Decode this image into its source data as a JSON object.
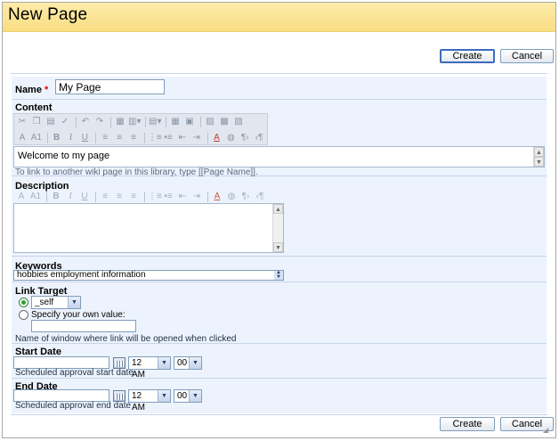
{
  "page": {
    "title": "New Page"
  },
  "actions": {
    "create_label": "Create",
    "cancel_label": "Cancel"
  },
  "form": {
    "name": {
      "label": "Name",
      "required_mark": "*",
      "value": "My Page"
    },
    "content": {
      "label": "Content",
      "value": "Welcome to my page",
      "hint": "To link to another wiki page in this library, type [[Page Name]].",
      "toolbar_icons": {
        "row1": [
          "cut-icon",
          "copy-icon",
          "paste-icon",
          "spellcheck-icon",
          "undo-icon",
          "redo-icon",
          "table-icon",
          "insert-table-icon",
          "insert-row-icon",
          "table-props-icon",
          "cell-props-icon",
          "insert-image-icon",
          "link-icon",
          "anchor-icon"
        ],
        "row2": [
          "font-icon",
          "font-size-icon",
          "bold-icon",
          "italic-icon",
          "underline-icon",
          "align-left-icon",
          "align-center-icon",
          "align-right-icon",
          "numbered-list-icon",
          "bullet-list-icon",
          "decrease-indent-icon",
          "increase-indent-icon",
          "text-color-icon",
          "background-color-icon",
          "ltr-icon",
          "rtl-icon"
        ]
      },
      "toolbar_glyphs": {
        "font": "A",
        "font_size": "A1",
        "bold": "B",
        "italic": "I",
        "underline": "U"
      }
    },
    "description": {
      "label": "Description",
      "value": ""
    },
    "keywords": {
      "label": "Keywords",
      "value": "hobbies employment information"
    },
    "link_target": {
      "label": "Link Target",
      "selected_option": "_self",
      "custom_label": "Specify your own value:",
      "custom_value": "",
      "hint": "Name of window where link will be opened when clicked"
    },
    "start_date": {
      "label": "Start Date",
      "date_value": "",
      "hour": "12 AM",
      "minute": "00",
      "hint": "Scheduled approval start date"
    },
    "end_date": {
      "label": "End Date",
      "date_value": "",
      "hour": "12 AM",
      "minute": "00",
      "hint": "Scheduled approval end date"
    }
  }
}
